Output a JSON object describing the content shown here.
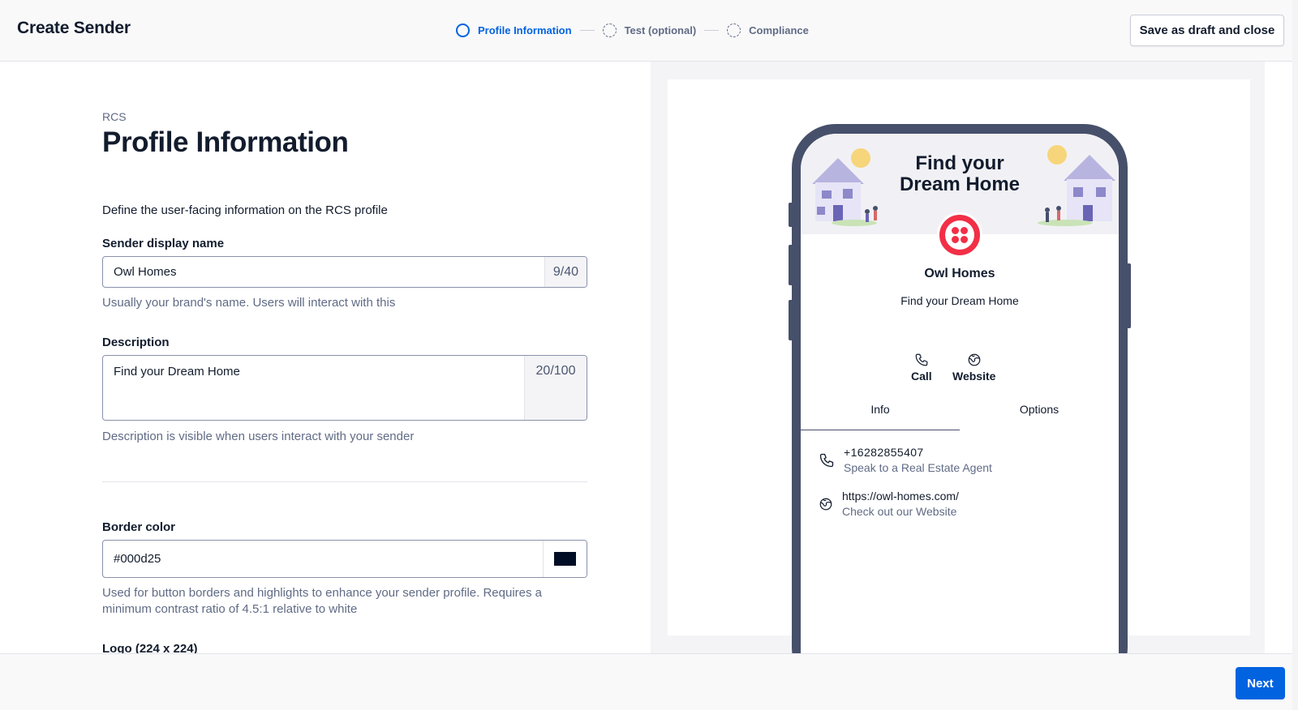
{
  "header": {
    "title": "Create Sender",
    "steps": [
      {
        "label": "Profile Information",
        "state": "active"
      },
      {
        "label": "Test (optional)",
        "state": "pending"
      },
      {
        "label": "Compliance",
        "state": "pending"
      }
    ],
    "draft_button": "Save as draft and close"
  },
  "form": {
    "eyebrow": "RCS",
    "title": "Profile Information",
    "intro": "Define the user-facing information on the RCS profile",
    "display_name": {
      "label": "Sender display name",
      "value": "Owl Homes",
      "counter": "9/40",
      "help": "Usually your brand's name. Users will interact with this"
    },
    "description": {
      "label": "Description",
      "value": "Find your Dream Home",
      "counter": "20/100",
      "help": "Description is visible when users interact with your sender"
    },
    "border_color": {
      "label": "Border color",
      "value": "#000d25",
      "swatch": "#000d25",
      "help_line1": "Used for button borders and highlights to enhance your sender profile. Requires a",
      "help_line2": "minimum contrast ratio of 4.5:1 relative to white"
    },
    "logo_label": "Logo (224 x 224)"
  },
  "preview": {
    "banner_title_line1": "Find your",
    "banner_title_line2": "Dream Home",
    "brand_name": "Owl Homes",
    "brand_description": "Find your Dream Home",
    "actions": [
      {
        "label": "Call",
        "icon": "phone-icon"
      },
      {
        "label": "Website",
        "icon": "globe-icon"
      }
    ],
    "tabs": [
      {
        "label": "Info",
        "active": true
      },
      {
        "label": "Options",
        "active": false
      }
    ],
    "info_rows": [
      {
        "icon": "phone-icon",
        "main": "+16282855407",
        "sub": "Speak to a Real Estate Agent"
      },
      {
        "icon": "globe-icon",
        "main": "https://owl-homes.com/",
        "sub": "Check out our Website"
      }
    ]
  },
  "footer": {
    "next_button": "Next"
  },
  "colors": {
    "accent": "#0263e0",
    "brand": "#f22f46",
    "phone_frame": "#46506b"
  }
}
